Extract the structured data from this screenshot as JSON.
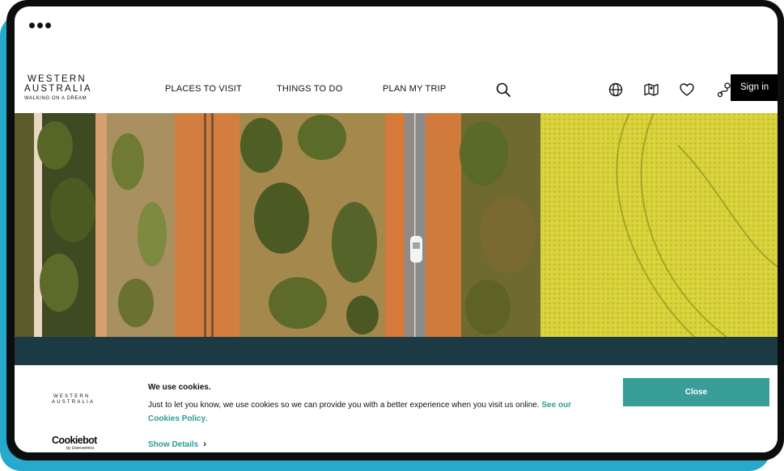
{
  "brand": {
    "line1": "WESTERN",
    "line2": "AUSTRALIA",
    "tagline": "WALKING ON A DREAM"
  },
  "nav": {
    "items": [
      {
        "label": "PLACES TO VISIT"
      },
      {
        "label": "THINGS TO DO"
      },
      {
        "label": "PLAN MY TRIP"
      }
    ],
    "sign_in": "Sign in",
    "icons": [
      "search-icon",
      "globe-icon",
      "map-icon",
      "heart-icon",
      "trip-route-icon"
    ]
  },
  "cookie_banner": {
    "logo_line1": "WESTERN",
    "logo_line2": "AUSTRALIA",
    "provider": "Cookiebot",
    "provider_sub": "by Usercentrics",
    "title": "We use cookies.",
    "text": "Just to let you know, we use cookies so we can provide you with a better experience when you visit us online.",
    "link_text": "See our Cookies Policy",
    "link_suffix": ".",
    "show_details": "Show Details",
    "close_label": "Close"
  },
  "colors": {
    "accent": "#27a9cc",
    "banner_band": "#1b3a44",
    "button": "#3a9e98",
    "link": "#2a9d96"
  }
}
